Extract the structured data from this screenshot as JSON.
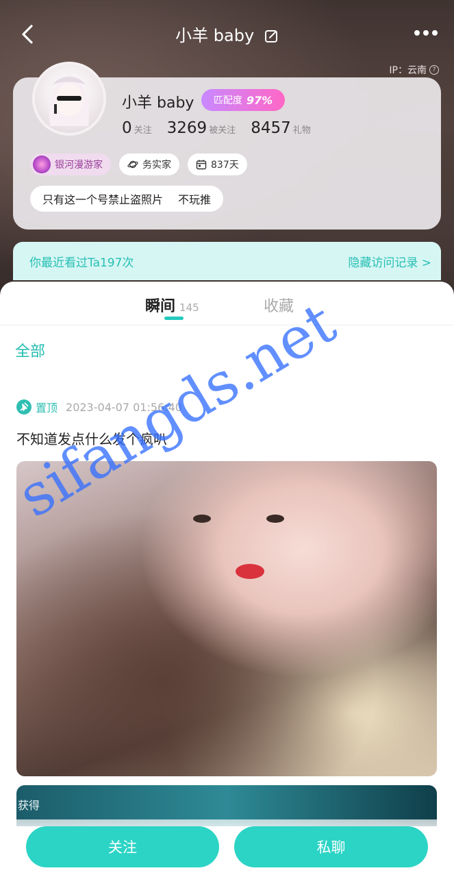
{
  "header": {
    "title": "小羊 baby",
    "ip_label": "IP：云南",
    "help_glyph": "?"
  },
  "profile": {
    "nickname": "小羊 baby",
    "match_label": "匹配度",
    "match_percent": "97%",
    "stats": [
      {
        "value": "0",
        "label": "关注"
      },
      {
        "value": "3269",
        "label": "被关注"
      },
      {
        "value": "8457",
        "label": "礼物"
      }
    ],
    "tags": {
      "level": "银河漫游家",
      "type": "务实家",
      "days": "837天"
    },
    "signature": [
      "只有这一个号禁止盗照片",
      "不玩推"
    ]
  },
  "visit_banner": {
    "text": "你最近看过Ta197次",
    "hide_link": "隐藏访问记录 >"
  },
  "tabs": {
    "moments": "瞬间",
    "moments_count": "145",
    "favorites": "收藏"
  },
  "filter": {
    "all": "全部"
  },
  "post": {
    "pinned_label": "置顶",
    "timestamp": "2023-04-07 01:56:40",
    "text": "不知道发点什么发个疯叭",
    "second_caption": "获得"
  },
  "actions": {
    "follow": "关注",
    "chat": "私聊"
  },
  "watermark": "sifangds.net",
  "colors": {
    "accent": "#2bd4c5",
    "accent_text": "#23bdb0",
    "match_gradient_start": "#c889ff",
    "match_gradient_end": "#ff67c6",
    "watermark": "#3470ff"
  }
}
